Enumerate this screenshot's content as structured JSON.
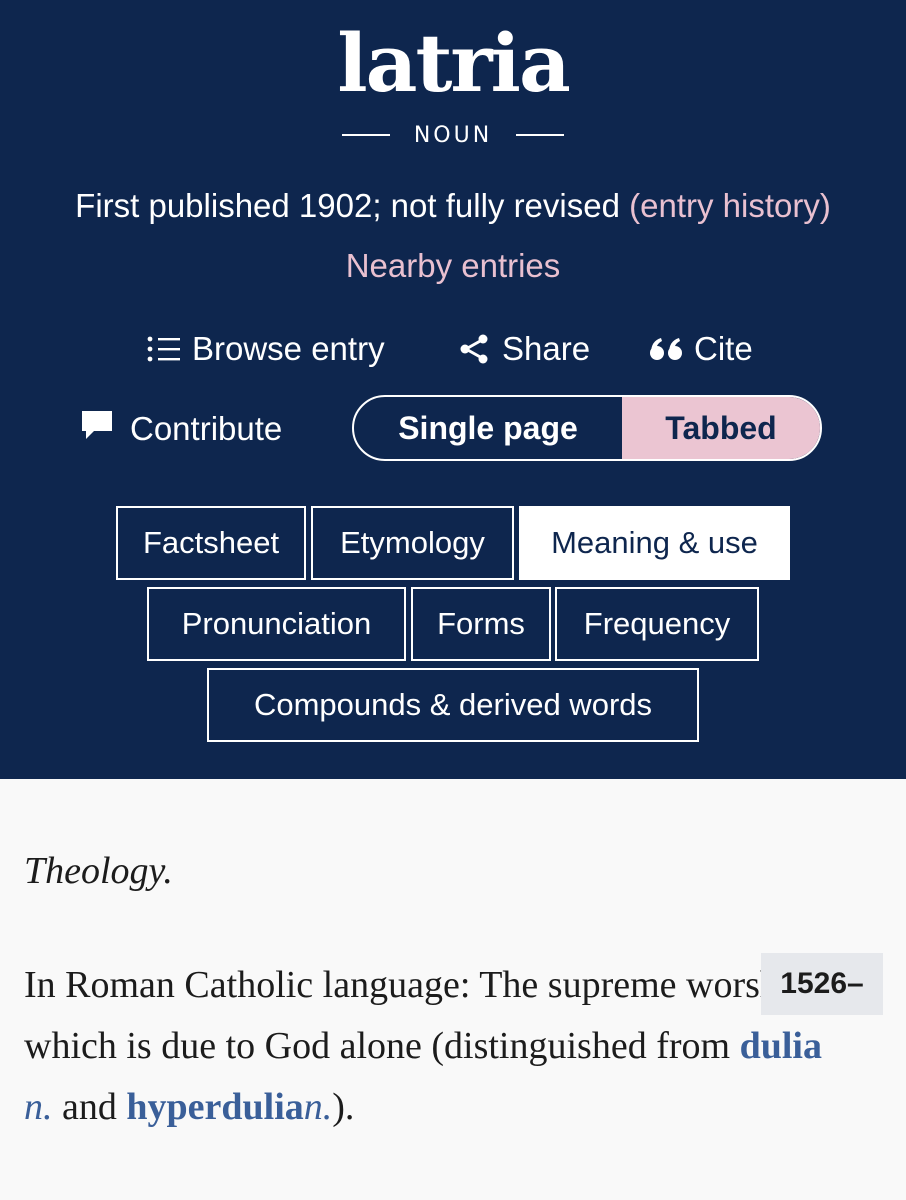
{
  "entry": {
    "headword": "latria",
    "part_of_speech": "NOUN",
    "publication_text": "First published 1902; not fully revised",
    "history_link": "(entry history)",
    "nearby_link": "Nearby entries"
  },
  "toolbar": {
    "browse_label": "Browse entry",
    "share_label": "Share",
    "cite_label": "Cite",
    "contribute_label": "Contribute"
  },
  "view_toggle": {
    "single_label": "Single page",
    "tabbed_label": "Tabbed",
    "selected": "Tabbed"
  },
  "tabs": [
    {
      "label": "Factsheet",
      "active": false
    },
    {
      "label": "Etymology",
      "active": false
    },
    {
      "label": "Meaning & use",
      "active": true
    },
    {
      "label": "Pronunciation",
      "active": false
    },
    {
      "label": "Forms",
      "active": false
    },
    {
      "label": "Frequency",
      "active": false
    },
    {
      "label": "Compounds & derived words",
      "active": false
    }
  ],
  "sense": {
    "subject_label": "Theology.",
    "definition_start": "In Roman Catholic language: The supreme worship which is due to God alone (distinguished from",
    "xref1_word": "dulia",
    "xref1_pos": "n.",
    "conjunction": "and",
    "xref2_word": "hyperdulia",
    "xref2_pos": "n.",
    "definition_end": ").",
    "date_range": "1526–"
  },
  "colors": {
    "header_bg": "#0e264e",
    "accent_pink": "#ebc5d2",
    "link_blue": "#3a5f99",
    "page_bg": "#f9f9f9"
  },
  "icons": {
    "browse": "list-icon",
    "share": "share-icon",
    "cite": "quote-icon",
    "contribute": "speech-bubble-icon"
  }
}
